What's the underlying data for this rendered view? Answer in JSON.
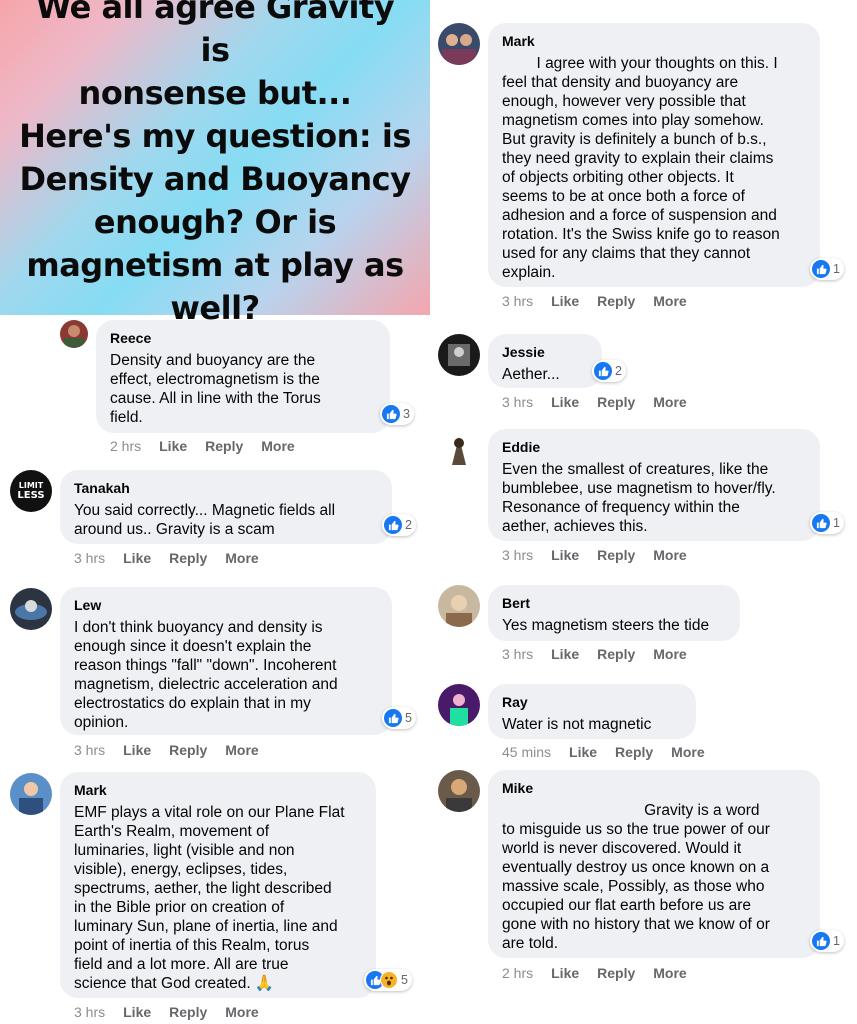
{
  "banner": {
    "lines": [
      "We all agree Gravity is",
      "nonsense but...",
      "Here's my question: is",
      "Density and Buoyancy",
      "enough? Or is",
      "magnetism at play as",
      "well?"
    ]
  },
  "comments": [
    {
      "name": "Reece",
      "text": "Density and buoyancy are the\neffect, electromagnetism is the\ncause. All in line with the Torus\nfield.",
      "time": "2 hrs",
      "like": "Like",
      "reply": "Reply",
      "more": "More",
      "reactions": "3"
    },
    {
      "name": "Tanakah",
      "text": "You said correctly... Magnetic fields all\naround us.. Gravity is a scam",
      "time": "3 hrs",
      "like": "Like",
      "reply": "Reply",
      "more": "More",
      "reactions": "2"
    },
    {
      "name": "Lew",
      "text": "I don't think buoyancy and density is\nenough since it doesn't explain the\nreason things \"fall\" \"down\". Incoherent\nmagnetism, dielectric acceleration and\nelectrostatics do explain that in my\nopinion.",
      "time": "3 hrs",
      "like": "Like",
      "reply": "Reply",
      "more": "More",
      "reactions": "5"
    },
    {
      "name": "Mark",
      "text": "EMF plays a vital role on our Plane Flat\nEarth's Realm, movement of\nluminaries, light (visible and non\nvisible), energy, eclipses, tides,\nspectrums, aether, the light described\nin the Bible prior on creation of\nluminary Sun, plane of inertia, line and\npoint of inertia of this Realm, torus\nfield and a lot more. All are true\nscience that God created. 🙏",
      "time": "3 hrs",
      "like": "Like",
      "reply": "Reply",
      "more": "More",
      "reactions": "5"
    },
    {
      "name": "Mark",
      "text": "        I agree with your thoughts on this. I\nfeel that density and buoyancy are\nenough, however very possible that\nmagnetism comes into play somehow.\nBut gravity is definitely a bunch of b.s.,\nthey need gravity to explain their claims\nof objects orbiting other objects. It\nseems to be at once both a force of\nadhesion and a force of suspension and\nrotation. It's the Swiss knife go to reason\nused for any claims that they cannot\nexplain.",
      "time": "3 hrs",
      "like": "Like",
      "reply": "Reply",
      "more": "More",
      "reactions": "1"
    },
    {
      "name": "Jessie",
      "text": "Aether...",
      "time": "3 hrs",
      "like": "Like",
      "reply": "Reply",
      "more": "More",
      "reactions": "2"
    },
    {
      "name": "Eddie",
      "text": "Even the smallest of creatures, like the\nbumblebee, use magnetism to hover/fly.\nResonance of frequency within the\naether, achieves this.",
      "time": "3 hrs",
      "like": "Like",
      "reply": "Reply",
      "more": "More",
      "reactions": "1"
    },
    {
      "name": "Bert",
      "text": "Yes magnetism steers the tide",
      "time": "3 hrs",
      "like": "Like",
      "reply": "Reply",
      "more": "More",
      "reactions": ""
    },
    {
      "name": "Ray",
      "text": "Water is not magnetic",
      "time": "45 mins",
      "like": "Like",
      "reply": "Reply",
      "more": "More",
      "reactions": ""
    },
    {
      "name": "Mike",
      "text": "                                 Gravity is a word\nto misguide us so the true power of our\nworld is never discovered. Would it\neventually destroy us once known on a\nmassive scale, Possibly, as those who\noccupied our flat earth before us are\ngone with no history that we know of or\nare told.",
      "time": "2 hrs",
      "like": "Like",
      "reply": "Reply",
      "more": "More",
      "reactions": "1"
    }
  ],
  "colors": {
    "bubble": "#eef0f4",
    "like_blue": "#1877f2",
    "meta_gray": "#65676b"
  },
  "icons": {
    "like": "thumbs-up-icon",
    "wow": "wow-face-icon"
  }
}
